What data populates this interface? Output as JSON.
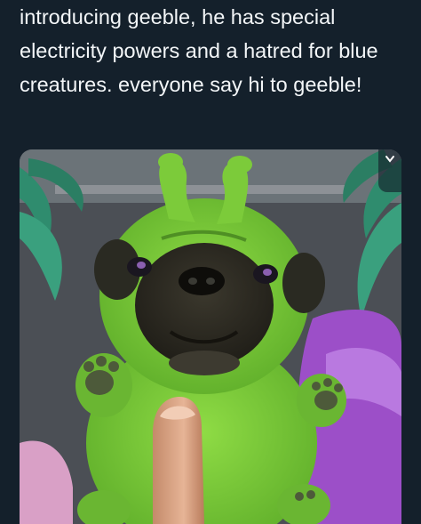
{
  "post": {
    "text": "introducing geeble, he has special electricity powers and a hatred for blue creatures. everyone say hi to geeble!"
  },
  "media": {
    "alt_icon": "chevron-down-icon"
  },
  "colors": {
    "background": "#14202b",
    "text": "#f3f6f8",
    "dog_green": "#7ccb3a",
    "dog_face": "#2c2a22",
    "pillow": "#9c4fc8"
  }
}
